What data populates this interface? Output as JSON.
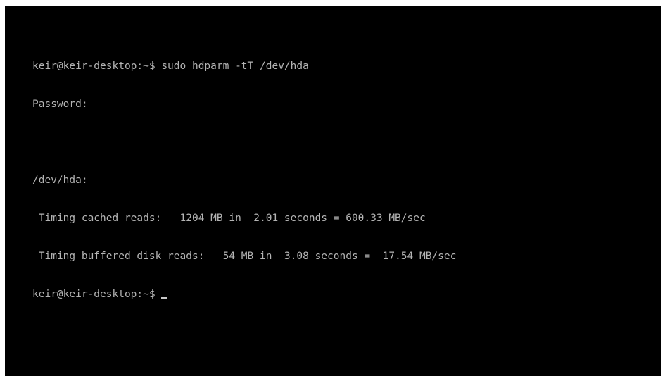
{
  "terminal": {
    "lines": [
      "keir@keir-desktop:~$ sudo hdparm -tT /dev/hda",
      "Password:",
      "",
      "/dev/hda:",
      " Timing cached reads:   1204 MB in  2.01 seconds = 600.33 MB/sec",
      " Timing buffered disk reads:   54 MB in  3.08 seconds =  17.54 MB/sec"
    ],
    "prompt": "keir@keir-desktop:~$ "
  },
  "colors": {
    "background": "#000000",
    "text": "#b4b4b4"
  }
}
